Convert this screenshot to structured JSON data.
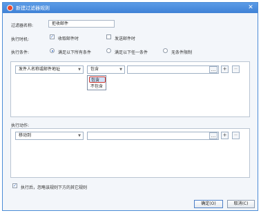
{
  "window": {
    "title": "新建过滤器规则"
  },
  "filter_name": {
    "label": "过滤器名称:",
    "value": "拒收邮件"
  },
  "exec_timing": {
    "label": "执行时机:",
    "options": [
      {
        "label": "收取邮件时",
        "checked": true
      },
      {
        "label": "发送邮件时",
        "checked": false
      }
    ]
  },
  "exec_condition": {
    "label": "执行条件:",
    "options": [
      {
        "label": "满足以下所有条件",
        "selected": true
      },
      {
        "label": "满足以下任一条件",
        "selected": false
      },
      {
        "label": "无条件限制",
        "selected": false
      }
    ]
  },
  "condition_row": {
    "field": "发件人名称或邮件地址",
    "operator": "包含",
    "value": "",
    "browse_label": "...",
    "add_label": "+",
    "remove_label": "−"
  },
  "operator_dropdown": {
    "items": [
      "包含",
      "不包含"
    ],
    "selected_index": 0
  },
  "actions": {
    "label": "执行动作:",
    "action": "移动到",
    "target": "",
    "browse_label": "...",
    "add_label": "+",
    "remove_label": "−"
  },
  "stop_rules": {
    "label": "执行后，忽略该规则下方的其它规则",
    "checked": true
  },
  "buttons": {
    "ok": "确定(O)",
    "cancel": "取消(C)"
  },
  "colors": {
    "titlebar": "#3f82d6",
    "highlight_border": "#d0332b"
  }
}
